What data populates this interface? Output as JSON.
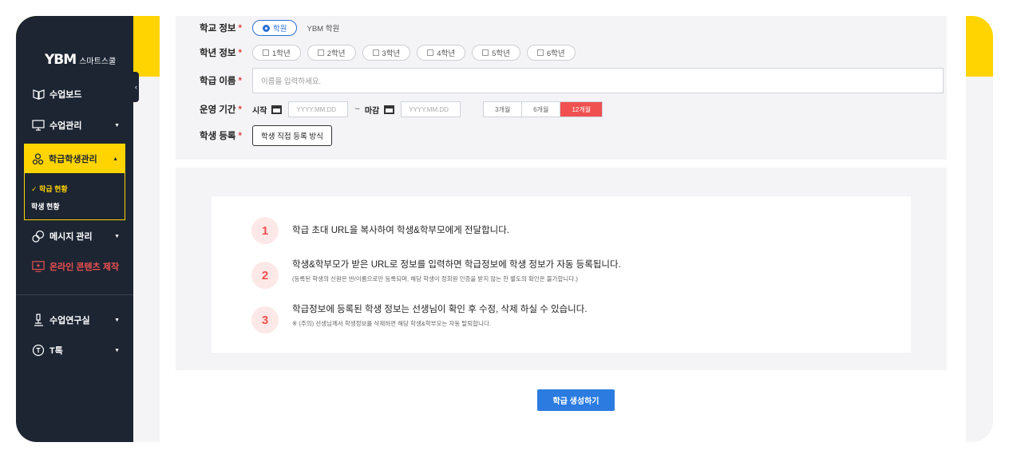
{
  "sidebar": {
    "logo_mark": "YBM",
    "logo_text": "스마트스쿨",
    "collapse_glyph": "‹",
    "items": [
      {
        "label": "수업보드",
        "icon": "board-icon"
      },
      {
        "label": "수업관리",
        "icon": "monitor-icon",
        "arrow": "▼"
      },
      {
        "label": "학급학생관리",
        "icon": "people-icon",
        "arrow": "▲"
      },
      {
        "label": "메시지 관리",
        "icon": "chat-icon",
        "arrow": "▼"
      },
      {
        "label": "온라인 콘텐츠 제작",
        "icon": "content-create-icon"
      },
      {
        "label": "수업연구실",
        "icon": "microscope-icon",
        "arrow": "▼"
      },
      {
        "label": "T톡",
        "icon": "talk-icon",
        "arrow": "▼"
      }
    ],
    "sub_items": [
      {
        "label": "✓ 학급 현황"
      },
      {
        "label": "학생 현황"
      }
    ],
    "colors": {
      "bg": "#1d2533",
      "accent": "#ffd400",
      "content_red": "#f05050"
    }
  },
  "form": {
    "school": {
      "label": "학교 정보",
      "options": [
        "학원",
        "YBM 학원"
      ],
      "selected": "학원"
    },
    "grade": {
      "label": "학년 정보",
      "options": [
        "1학년",
        "2학년",
        "3학년",
        "4학년",
        "5학년",
        "6학년"
      ]
    },
    "class_name": {
      "label": "학급 이름",
      "placeholder": "이름을 입력하세요."
    },
    "period": {
      "label": "운영 기간",
      "start_label": "시작",
      "end_label": "마감",
      "date_placeholder": "YYYY.MM.DD",
      "tilde": "~",
      "options": [
        "3개월",
        "6개월",
        "12개월"
      ],
      "selected": "12개월"
    },
    "student": {
      "label": "학생 등록",
      "button": "학생 직접 등록 방식"
    },
    "required_mark": "*"
  },
  "steps": [
    {
      "num": "1",
      "text": "학급 초대 URL을 복사하여 학생&학부모에게 전달합니다.",
      "sub": ""
    },
    {
      "num": "2",
      "text": "학생&학부모가 받은 URL로 정보를 입력하면 학급정보에 학생 정보가 자동 등록됩니다.",
      "sub": "(등록된 학생의 신원은 반/이름으로만 등록되며, 해당 학생이 정회원 인증을 받지 않는 한 별도의 확인은 불가합니다.)"
    },
    {
      "num": "3",
      "text": "학급정보에 등록된 학생 정보는 선생님이 확인 후 수정, 삭제 하실 수 있습니다.",
      "sub": "※ (주의) 선생님께서 학생정보를 삭제하면 해당 학생&학부모는 자동 탈퇴합니다."
    }
  ],
  "submit_label": "학급 생성하기",
  "colors": {
    "primary": "#2b7be0",
    "accent_yellow": "#ffd400",
    "danger": "#f05050"
  }
}
